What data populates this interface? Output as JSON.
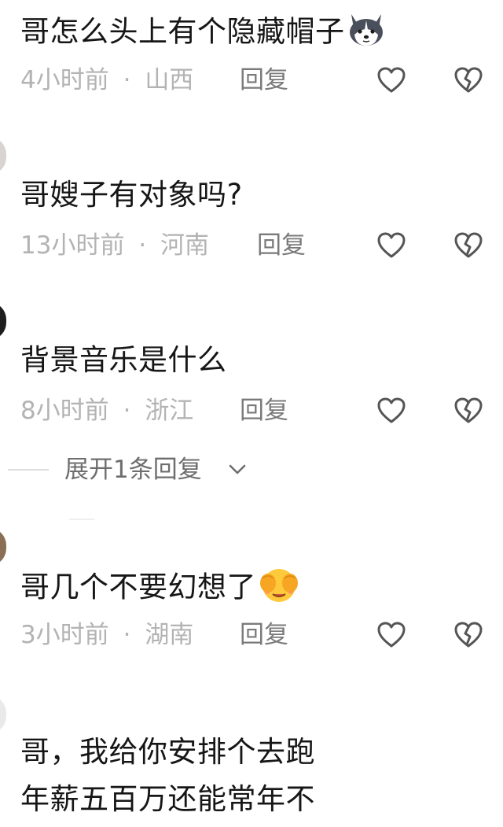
{
  "comments": [
    {
      "text": "哥怎么头上有个隐藏帽子",
      "emoji": "husky-dog-emoji",
      "time": "4小时前",
      "separator": "·",
      "location": "山西",
      "reply_label": "回复"
    },
    {
      "text": "哥嫂子有对象吗?",
      "time": "13小时前",
      "separator": "·",
      "location": "河南",
      "reply_label": "回复"
    },
    {
      "text": "背景音乐是什么",
      "time": "8小时前",
      "separator": "·",
      "location": "浙江",
      "reply_label": "回复"
    },
    {
      "text": "哥几个不要幻想了",
      "emoji": "face-covering-eyes-emoji",
      "time": "3小时前",
      "separator": "·",
      "location": "湖南",
      "reply_label": "回复"
    },
    {
      "lines": [
        "哥，我给你安排个去跑",
        "年薪五百万还能常年不"
      ]
    }
  ],
  "expand_replies": {
    "label": "展开1条回复"
  },
  "icons": {
    "like": "heart-outline-icon",
    "dislike": "broken-heart-icon",
    "chevron": "chevron-down-icon"
  },
  "colors": {
    "text": "#161616",
    "meta": "#b3b3b3",
    "reply": "#7a7a7a",
    "icon": "#555555"
  }
}
